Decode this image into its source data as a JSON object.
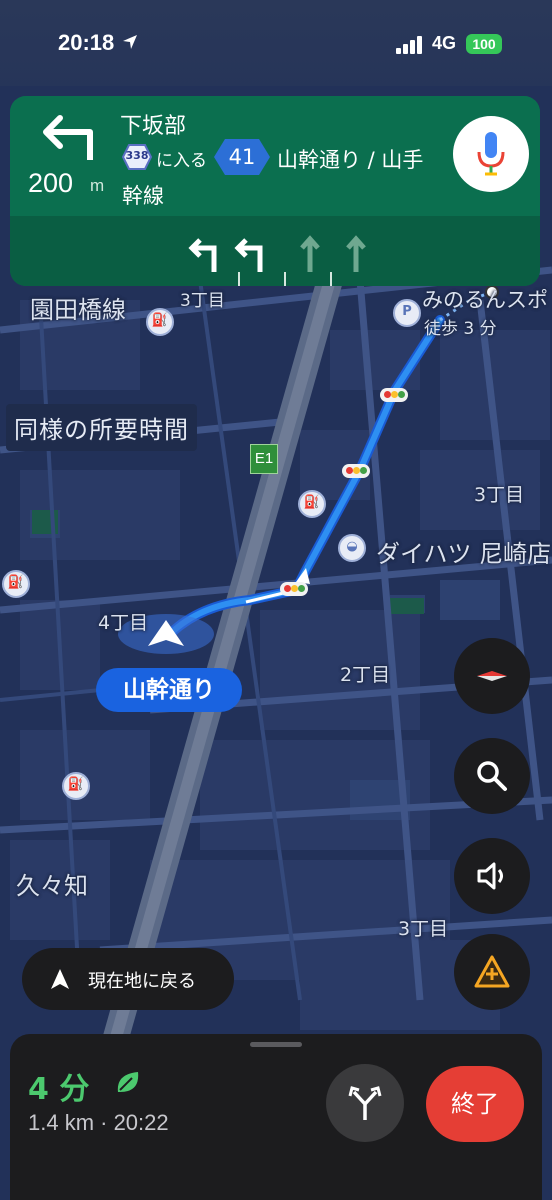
{
  "status_bar": {
    "time": "20:18",
    "network": "4G",
    "battery": "100"
  },
  "nav": {
    "place": "下坂部",
    "route_number": "338",
    "enter_text": "に入る",
    "highway_number": "41",
    "street_line1": "山幹通り / 山手",
    "street_line2": "幹線",
    "distance": "200",
    "distance_unit": "m",
    "lanes": [
      "left",
      "left",
      "straight",
      "straight"
    ]
  },
  "map": {
    "labels": {
      "district_top": "3丁目",
      "sonoda": "園田橋線",
      "minoru": "みのるんスポ",
      "walk": "徒歩 3 分",
      "same_time": "同様の所要時間",
      "e1": "E1",
      "block_3chome_right": "3丁目",
      "daihatsu": "ダイハツ 尼崎店",
      "block_4chome": "4丁目",
      "block_2chome": "2丁目",
      "kukuchi": "久々知",
      "block_3chome_bottom": "3丁目"
    },
    "current_street": "山幹通り"
  },
  "controls": {
    "recenter": "現在地に戻る"
  },
  "bottom": {
    "eta_minutes": "4 分",
    "eta_info": "1.4 km · 20:22",
    "end_button": "終了"
  }
}
